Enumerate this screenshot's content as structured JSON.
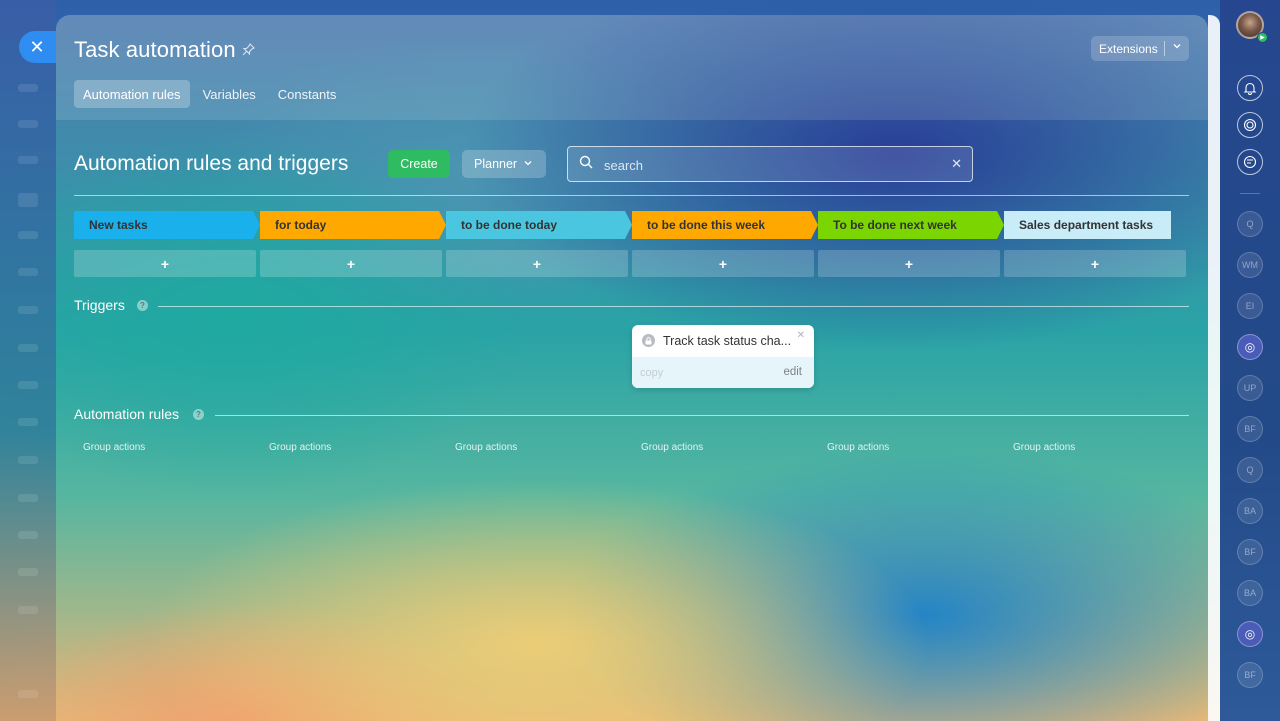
{
  "panel": {
    "title": "Task automation",
    "extensions_label": "Extensions",
    "tabs": [
      {
        "label": "Automation rules",
        "active": true
      },
      {
        "label": "Variables",
        "active": false
      },
      {
        "label": "Constants",
        "active": false
      }
    ]
  },
  "toolbar": {
    "heading": "Automation rules and triggers",
    "create_label": "Create",
    "planner_label": "Planner",
    "search_placeholder": "search"
  },
  "stages": [
    {
      "label": "New tasks",
      "color": "#1ab0ec"
    },
    {
      "label": "for today",
      "color": "#ffa900"
    },
    {
      "label": "to be done today",
      "color": "#4bc6e0"
    },
    {
      "label": "to be done this week",
      "color": "#ffa900"
    },
    {
      "label": "To be done next week",
      "color": "#7bd500"
    },
    {
      "label": "Sales department tasks",
      "color": "#c8ecf8"
    }
  ],
  "add_label": "+",
  "triggers": {
    "title": "Triggers",
    "help": "?",
    "card": {
      "name": "Track task status cha...",
      "copy_label": "copy",
      "edit_label": "edit"
    }
  },
  "automation_rules": {
    "title": "Automation rules",
    "help": "?",
    "group_actions": [
      "Group actions",
      "Group actions",
      "Group actions",
      "Group actions",
      "Group actions",
      "Group actions"
    ]
  },
  "right_bar": {
    "chats": [
      "Q",
      "WM",
      "EI",
      "",
      "UP",
      "BF",
      "Q",
      "BA",
      "BF",
      "BA",
      "",
      "BF"
    ]
  }
}
